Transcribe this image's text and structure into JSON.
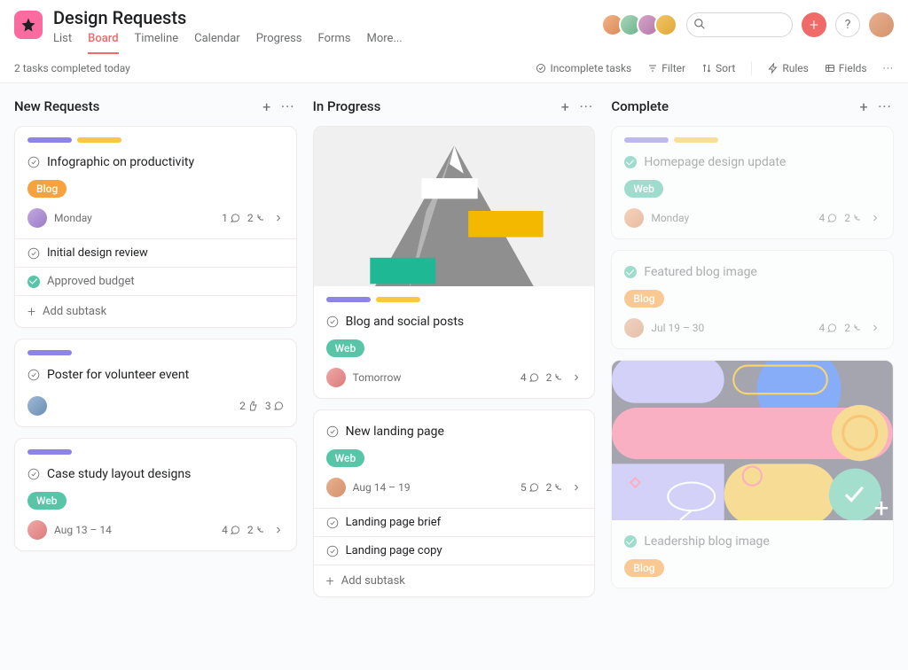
{
  "header": {
    "title": "Design Requests",
    "tabs": [
      "List",
      "Board",
      "Timeline",
      "Calendar",
      "Progress",
      "Forms",
      "More..."
    ],
    "active_tab": 1,
    "search_placeholder": ""
  },
  "subbar": {
    "status": "2 tasks completed today",
    "incomplete": "Incomplete tasks",
    "filter": "Filter",
    "sort": "Sort",
    "rules": "Rules",
    "fields": "Fields"
  },
  "columns": [
    {
      "title": "New Requests",
      "cards": [
        {
          "bars": [
            "purple",
            "yellow"
          ],
          "title": "Infographic on productivity",
          "tag": {
            "label": "Blog",
            "cls": "blog"
          },
          "due": "Monday",
          "avatar": "o7",
          "meta": {
            "comments": "1",
            "subtasks": "2"
          },
          "subtasks": [
            {
              "done": false,
              "label": "Initial design review"
            },
            {
              "done": true,
              "label": "Approved budget"
            }
          ],
          "add_sub": "Add subtask"
        },
        {
          "bars": [
            "purple"
          ],
          "title": "Poster for volunteer event",
          "avatar": "o6",
          "meta": {
            "likes": "2",
            "comments": "3"
          }
        },
        {
          "bars": [
            "purple"
          ],
          "title": "Case study layout designs",
          "tag": {
            "label": "Web",
            "cls": "web"
          },
          "due": "Aug 13 – 14",
          "avatar": "o8",
          "meta": {
            "comments": "4",
            "subtasks": "2"
          }
        }
      ]
    },
    {
      "title": "In Progress",
      "cards": [
        {
          "cover": "mountain",
          "bars": [
            "purple",
            "yellow"
          ],
          "title": "Blog and social posts",
          "tag": {
            "label": "Web",
            "cls": "web"
          },
          "due": "Tomorrow",
          "avatar": "o8",
          "meta": {
            "comments": "4",
            "subtasks": "2"
          }
        },
        {
          "title": "New landing page",
          "tag": {
            "label": "Web",
            "cls": "web"
          },
          "due": "Aug 14 – 19",
          "avatar": "o5",
          "meta": {
            "comments": "5",
            "subtasks": "2"
          },
          "subtasks": [
            {
              "done": false,
              "label": "Landing page brief"
            },
            {
              "done": false,
              "label": "Landing page copy"
            }
          ],
          "add_sub": "Add subtask"
        }
      ]
    },
    {
      "title": "Complete",
      "faded": true,
      "cards": [
        {
          "bars": [
            "purple",
            "yellow"
          ],
          "done": true,
          "title": "Homepage design update",
          "tag": {
            "label": "Web",
            "cls": "web"
          },
          "due": "Monday",
          "avatar": "o1",
          "meta": {
            "comments": "4",
            "subtasks": "2"
          }
        },
        {
          "done": true,
          "title": "Featured blog image",
          "tag": {
            "label": "Blog",
            "cls": "blog"
          },
          "due": "Jul 19 – 30",
          "avatar": "o5",
          "meta": {
            "comments": "4",
            "subtasks": "2"
          }
        },
        {
          "cover": "shapes",
          "done": true,
          "title": "Leadership blog image",
          "tag": {
            "label": "Blog",
            "cls": "blog"
          }
        }
      ]
    }
  ]
}
